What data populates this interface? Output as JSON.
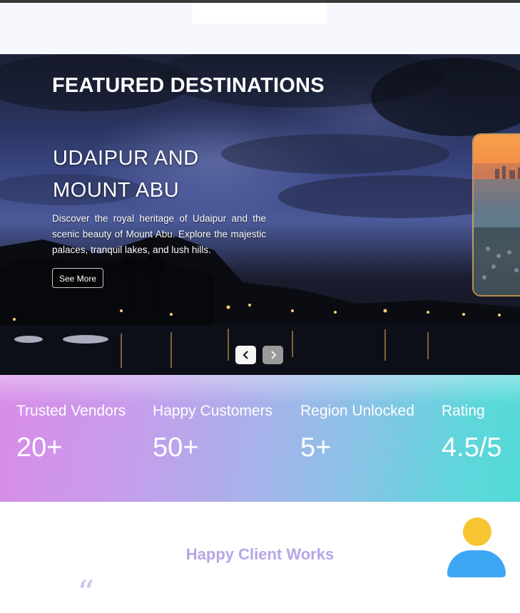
{
  "header": {},
  "hero": {
    "heading": "FEATURED DESTINATIONS",
    "slide": {
      "title_line1": "UDAIPUR AND",
      "title_line2": "MOUNT ABU",
      "description": "Discover the royal heritage of Udaipur and the scenic beauty of Mount Abu. Explore the majestic palaces, tranquil lakes, and lush hills.",
      "button_label": "See More"
    },
    "prev_icon": "chevron-left-icon",
    "next_icon": "chevron-right-icon"
  },
  "stats": [
    {
      "label": "Trusted Vendors",
      "value": "20+"
    },
    {
      "label": "Happy Customers",
      "value": "50+"
    },
    {
      "label": "Region Unlocked",
      "value": "5+"
    },
    {
      "label": "Rating",
      "value": "4.5/5"
    }
  ],
  "testimonials": {
    "title": "Happy Client Works",
    "quote_glyph": "“",
    "avatar_icon": "user-avatar-icon"
  },
  "colors": {
    "stats_gradient_start": "#d98ce8",
    "stats_gradient_end": "#52dbd6",
    "testimonial_title": "#b6a6e6",
    "avatar_head": "#f7c531",
    "avatar_body": "#3ea7f4"
  }
}
